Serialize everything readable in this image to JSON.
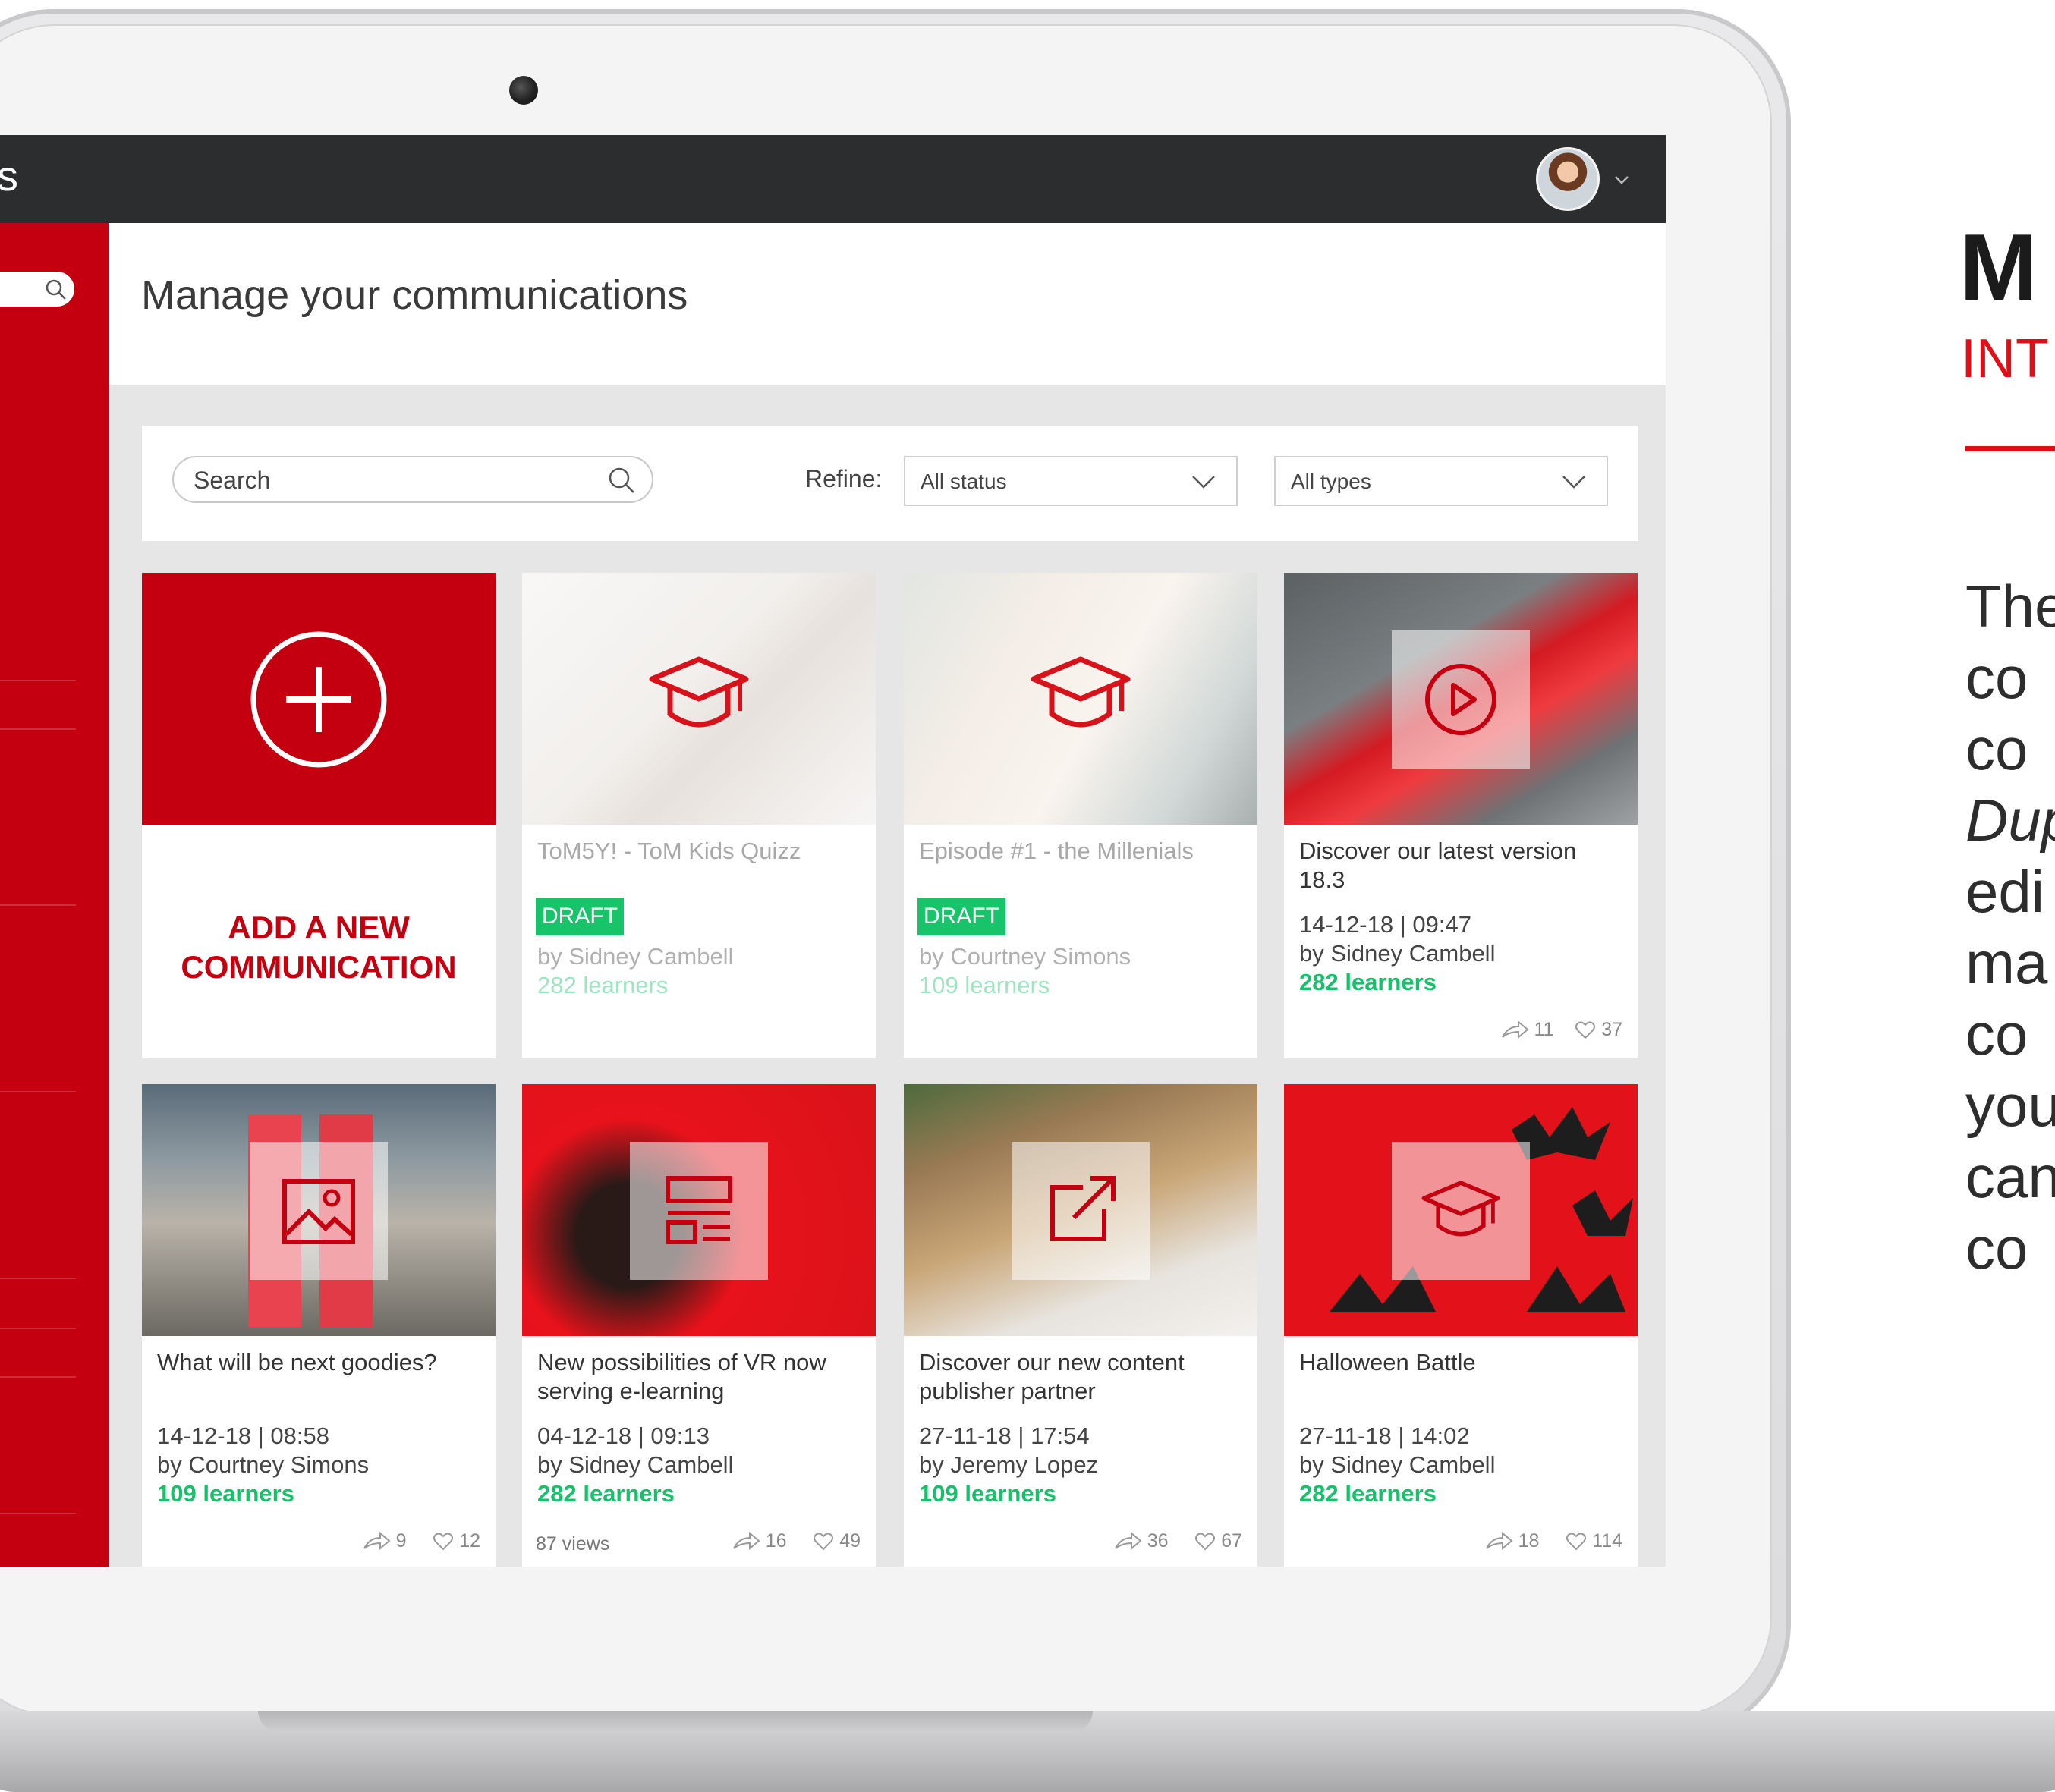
{
  "app": {
    "title_fragment": "s"
  },
  "header": {
    "page_title": "Manage your communications"
  },
  "filters": {
    "search_placeholder": "Search",
    "refine_label": "Refine:",
    "status_selected": "All status",
    "types_selected": "All types"
  },
  "add_card": {
    "label_line1": "ADD A NEW",
    "label_line2": "COMMUNICATION"
  },
  "cards": [
    {
      "title": "ToM5Y! - ToM Kids Quizz",
      "status": "DRAFT",
      "author": "by Sidney Cambell",
      "learners": "282 learners",
      "icon": "graduation-cap-icon"
    },
    {
      "title": "Episode #1 - the Millenials",
      "status": "DRAFT",
      "author": "by Courtney Simons",
      "learners": "109 learners",
      "icon": "graduation-cap-icon"
    },
    {
      "title": "Discover our latest version 18.3",
      "date": "14-12-18  |  09:47",
      "author": "by Sidney Cambell",
      "learners": "282 learners",
      "shares": "11",
      "likes": "37",
      "icon": "play-icon"
    },
    {
      "title": "What will be next goodies?",
      "date": "14-12-18  |  08:58",
      "author": "by Courtney Simons",
      "learners": "109 learners",
      "shares": "9",
      "likes": "12",
      "icon": "image-icon"
    },
    {
      "title": "New possibilities of VR now serving e-learning",
      "date": "04-12-18  |  09:13",
      "author": "by Sidney Cambell",
      "learners": "282 learners",
      "views": "87 views",
      "shares": "16",
      "likes": "49",
      "icon": "article-icon"
    },
    {
      "title": "Discover our new content publisher partner",
      "date": "27-11-18  |  17:54",
      "author": "by Jeremy Lopez",
      "learners": "109 learners",
      "shares": "36",
      "likes": "67",
      "icon": "external-link-icon"
    },
    {
      "title": "Halloween Battle",
      "date": "27-11-18  |  14:02",
      "author": "by Sidney Cambell",
      "learners": "282 learners",
      "shares": "18",
      "likes": "114",
      "icon": "graduation-cap-icon"
    }
  ],
  "right_panel": {
    "title_fragment": "M",
    "subtitle_fragment": "INT",
    "body_lines": [
      "The",
      "co",
      "co",
      "Dup",
      "edi",
      "ma",
      "co",
      "you",
      "can",
      "co"
    ]
  },
  "colors": {
    "brand_red": "#c40010",
    "accent_red": "#e00e16",
    "learners_green": "#17c06b",
    "draft_green": "#18c46a",
    "topbar": "#2b2d2e"
  }
}
